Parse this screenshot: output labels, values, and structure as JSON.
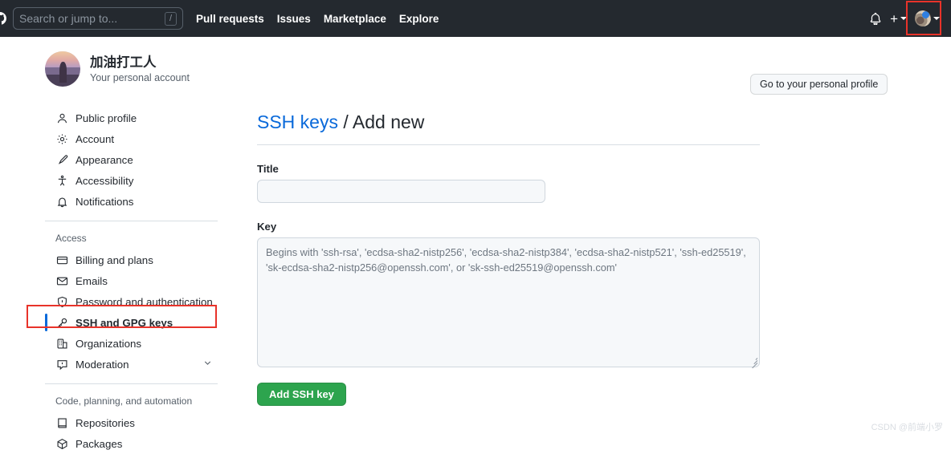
{
  "header": {
    "logo_icon": "github-mark-icon",
    "search": {
      "placeholder": "Search or jump to...",
      "shortcut_key": "/"
    },
    "nav": [
      {
        "label": "Pull requests"
      },
      {
        "label": "Issues"
      },
      {
        "label": "Marketplace"
      },
      {
        "label": "Explore"
      }
    ],
    "notifications_icon": "bell-icon",
    "create_new_icon": "plus-icon",
    "create_new_caret_icon": "caret-down-icon",
    "avatar_icon": "user-avatar-icon",
    "avatar_caret_icon": "caret-down-icon",
    "background_color": "#24292f"
  },
  "sidebar": {
    "account": {
      "avatar_icon": "user-avatar-icon",
      "name": "加油打工人",
      "subtitle": "Your personal account"
    },
    "items": [
      {
        "label": "Public profile",
        "icon": "person-icon",
        "selected": false
      },
      {
        "label": "Account",
        "icon": "gear-icon",
        "selected": false
      },
      {
        "label": "Appearance",
        "icon": "paintbrush-icon",
        "selected": false
      },
      {
        "label": "Accessibility",
        "icon": "accessibility-icon",
        "selected": false
      },
      {
        "label": "Notifications",
        "icon": "bell-icon",
        "selected": false
      }
    ],
    "access_group": {
      "title": "Access",
      "items": [
        {
          "label": "Billing and plans",
          "icon": "credit-card-icon",
          "selected": false
        },
        {
          "label": "Emails",
          "icon": "mail-icon",
          "selected": false
        },
        {
          "label": "Password and authentication",
          "icon": "shield-lock-icon",
          "selected": false
        },
        {
          "label": "SSH and GPG keys",
          "icon": "key-icon",
          "selected": true
        },
        {
          "label": "Organizations",
          "icon": "organization-icon",
          "selected": false
        },
        {
          "label": "Moderation",
          "icon": "report-icon",
          "selected": false,
          "expandable": true
        }
      ]
    },
    "code_group": {
      "title": "Code, planning, and automation",
      "items": [
        {
          "label": "Repositories",
          "icon": "repo-icon",
          "selected": false
        },
        {
          "label": "Packages",
          "icon": "package-icon",
          "selected": false
        }
      ]
    },
    "selected_accent_color": "#0969da"
  },
  "main": {
    "personal_profile_button": "Go to your personal profile",
    "breadcrumb_link": "SSH keys",
    "breadcrumb_separator": " / ",
    "breadcrumb_current": "Add new",
    "title_field": {
      "label": "Title",
      "value": "",
      "placeholder": ""
    },
    "key_field": {
      "label": "Key",
      "value": "",
      "placeholder": "Begins with 'ssh-rsa', 'ecdsa-sha2-nistp256', 'ecdsa-sha2-nistp384', 'ecdsa-sha2-nistp521', 'ssh-ed25519', 'sk-ecdsa-sha2-nistp256@openssh.com', or 'sk-ssh-ed25519@openssh.com'"
    },
    "submit_button": "Add SSH key",
    "submit_button_color": "#2da44e"
  },
  "annotations": {
    "highlight_color": "#e8332a",
    "boxes": [
      {
        "target": "avatar-menu",
        "name": "avatar-highlight-box"
      },
      {
        "target": "ssh-and-gpg-keys",
        "name": "ssh-keys-highlight-box"
      }
    ]
  },
  "watermark": {
    "text": "CSDN @前端小罗"
  }
}
